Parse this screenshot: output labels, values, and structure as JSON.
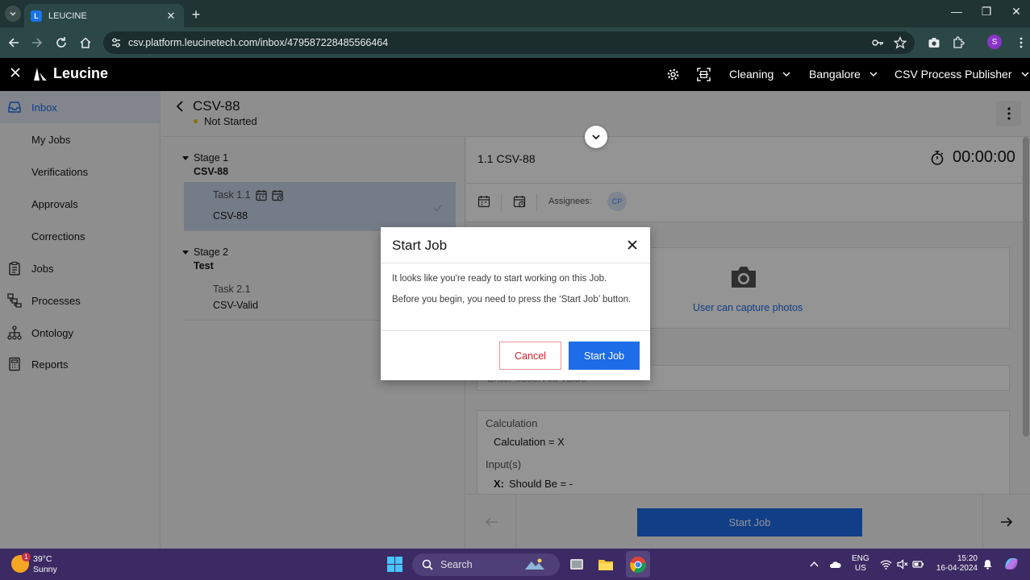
{
  "browser": {
    "tab_title": "LEUCINE",
    "tab_favicon": "L",
    "url": "csv.platform.leucinetech.com/inbox/479587228485566464",
    "profile_initial": "S"
  },
  "header": {
    "logo_text": "Leucine",
    "facility": "Cleaning",
    "site": "Bangalore",
    "role": "CSV Process Publisher"
  },
  "sidebar": {
    "items": [
      {
        "label": "Inbox",
        "icon": "inbox-icon",
        "active": true
      },
      {
        "label": "My Jobs"
      },
      {
        "label": "Verifications"
      },
      {
        "label": "Approvals"
      },
      {
        "label": "Corrections"
      },
      {
        "label": "Jobs",
        "icon": "clipboard-icon"
      },
      {
        "label": "Processes",
        "icon": "process-icon"
      },
      {
        "label": "Ontology",
        "icon": "hierarchy-icon"
      },
      {
        "label": "Reports",
        "icon": "report-icon"
      }
    ]
  },
  "job": {
    "title": "CSV-88",
    "status": "Not Started",
    "status_color": "#f1c21b"
  },
  "stages": [
    {
      "label": "Stage 1",
      "name": "CSV-88",
      "tasks": [
        {
          "label": "Task 1.1",
          "name": "CSV-88"
        }
      ]
    },
    {
      "label": "Stage 2",
      "name": "Test",
      "tasks": [
        {
          "label": "Task 2.1",
          "name": "CSV-Valid"
        }
      ]
    }
  ],
  "task": {
    "title": "1.1 CSV-88",
    "timer": "00:00:00",
    "assignees_label": "Assignees:",
    "assignee_initials": "CP",
    "photo_caption": "User can capture photos",
    "observed_placeholder": "Enter observed value",
    "calculation": {
      "heading": "Calculation",
      "formula": "Calculation = X",
      "inputs_heading": "Input(s)",
      "var_name": "X:",
      "var_text": "Should Be = -"
    },
    "footer_start_label": "Start Job"
  },
  "modal": {
    "title": "Start Job",
    "line1": "It looks like you're ready to start working on this Job.",
    "line2": "Before you begin, you need to press the ‘Start Job’ button.",
    "cancel_label": "Cancel",
    "confirm_label": "Start Job"
  },
  "taskbar": {
    "temperature": "39°C",
    "weather": "Sunny",
    "weather_badge": "1",
    "search_label": "Search",
    "lang_line1": "ENG",
    "lang_line2": "US",
    "time": "15:20",
    "date": "16-04-2024"
  },
  "colors": {
    "accent": "#1d6ce8",
    "danger": "#da1e28",
    "browser_frame": "#1f3433",
    "taskbar": "#3b2a63"
  }
}
